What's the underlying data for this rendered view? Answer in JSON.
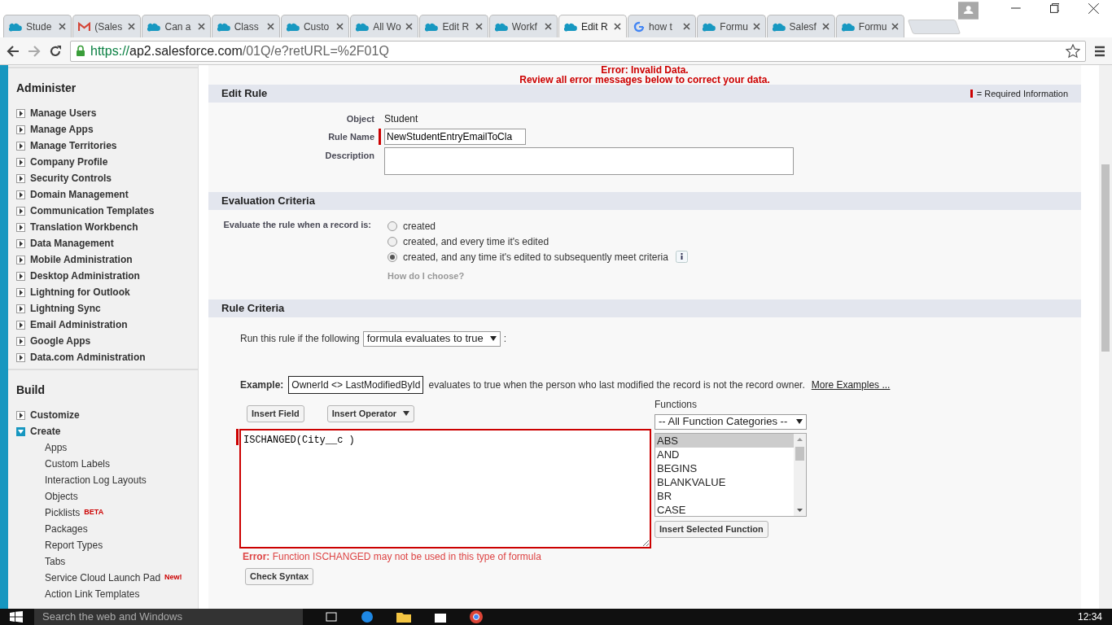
{
  "browser": {
    "tabs": [
      {
        "label": "Stude",
        "kind": "cloud",
        "selected": false
      },
      {
        "label": "(Sales",
        "kind": "mail",
        "selected": false
      },
      {
        "label": "Can a",
        "kind": "cloud",
        "selected": false
      },
      {
        "label": "Class",
        "kind": "cloud",
        "selected": false
      },
      {
        "label": "Custo",
        "kind": "cloud",
        "selected": false
      },
      {
        "label": "All Wo",
        "kind": "cloud",
        "selected": false
      },
      {
        "label": "Edit R",
        "kind": "cloud",
        "selected": false
      },
      {
        "label": "Workf",
        "kind": "cloud",
        "selected": false
      },
      {
        "label": "Edit R",
        "kind": "cloud",
        "selected": true
      },
      {
        "label": "how t",
        "kind": "google",
        "selected": false
      },
      {
        "label": "Formu",
        "kind": "cloud",
        "selected": false
      },
      {
        "label": "Salesf",
        "kind": "cloud",
        "selected": false
      },
      {
        "label": "Formu",
        "kind": "cloud",
        "selected": false
      }
    ],
    "url": {
      "scheme": "https://",
      "host": "ap2.salesforce.com",
      "path": "/01Q/e?retURL=%2F01Q"
    }
  },
  "sidebar": {
    "sections": [
      {
        "title": "Administer",
        "items": [
          {
            "label": "Manage Users",
            "expanded": false
          },
          {
            "label": "Manage Apps",
            "expanded": false
          },
          {
            "label": "Manage Territories",
            "expanded": false
          },
          {
            "label": "Company Profile",
            "expanded": false
          },
          {
            "label": "Security Controls",
            "expanded": false
          },
          {
            "label": "Domain Management",
            "expanded": false
          },
          {
            "label": "Communication Templates",
            "expanded": false
          },
          {
            "label": "Translation Workbench",
            "expanded": false
          },
          {
            "label": "Data Management",
            "expanded": false
          },
          {
            "label": "Mobile Administration",
            "expanded": false
          },
          {
            "label": "Desktop Administration",
            "expanded": false
          },
          {
            "label": "Lightning for Outlook",
            "expanded": false
          },
          {
            "label": "Lightning Sync",
            "expanded": false
          },
          {
            "label": "Email Administration",
            "expanded": false
          },
          {
            "label": "Google Apps",
            "expanded": false
          },
          {
            "label": "Data.com Administration",
            "expanded": false
          }
        ]
      },
      {
        "title": "Build",
        "items": [
          {
            "label": "Customize",
            "expanded": false
          },
          {
            "label": "Create",
            "expanded": true,
            "children": [
              {
                "label": "Apps"
              },
              {
                "label": "Custom Labels"
              },
              {
                "label": "Interaction Log Layouts"
              },
              {
                "label": "Objects"
              },
              {
                "label": "Picklists",
                "badge": "BETA"
              },
              {
                "label": "Packages"
              },
              {
                "label": "Report Types"
              },
              {
                "label": "Tabs"
              },
              {
                "label": "Service Cloud Launch Pad",
                "badge": "New!"
              },
              {
                "label": "Action Link Templates"
              }
            ]
          }
        ]
      }
    ]
  },
  "page": {
    "errors": [
      "Error: Invalid Data.",
      "Review all error messages below to correct your data."
    ],
    "edit_rule": {
      "title": "Edit Rule",
      "required_legend": "= Required Information",
      "fields": [
        {
          "label": "Object",
          "kind": "text",
          "value": "Student",
          "required": false
        },
        {
          "label": "Rule Name",
          "kind": "input",
          "value": "NewStudentEntryEmailToCla",
          "required": true
        },
        {
          "label": "Description",
          "kind": "textarea",
          "required": false
        }
      ]
    },
    "evaluation": {
      "title": "Evaluation Criteria",
      "label": "Evaluate the rule when a record is:",
      "options": [
        {
          "label": "created",
          "selected": false,
          "info": false
        },
        {
          "label": "created, and every time it's edited",
          "selected": false,
          "info": false
        },
        {
          "label": "created, and any time it's edited to subsequently meet criteria",
          "selected": true,
          "info": true
        }
      ],
      "help_link": "How do I choose?"
    },
    "rule_criteria": {
      "title": "Rule Criteria",
      "run_label": "Run this rule if the following",
      "criteria_select": "formula evaluates to true",
      "suffix": ":",
      "example": {
        "label": "Example:",
        "code": "OwnerId <> LastModifiedById",
        "text": "evaluates to true when the person who last modified the record is not the record owner.",
        "link": "More Examples ..."
      },
      "buttons": [
        {
          "label": "Insert Field",
          "kind": "plain"
        },
        {
          "label": "Insert Operator",
          "kind": "dropdown"
        }
      ],
      "formula": "ISCHANGED(City__c )",
      "error": "**Error:** Function ISCHANGED may not be used in this type of formula",
      "check_button": "Check Syntax",
      "functions": {
        "label": "Functions",
        "category": "-- All Function Categories --",
        "items": [
          {
            "label": "ABS",
            "selected": true
          },
          {
            "label": "AND",
            "selected": false
          },
          {
            "label": "BEGINS",
            "selected": false
          },
          {
            "label": "BLANKVALUE",
            "selected": false
          },
          {
            "label": "BR",
            "selected": false
          },
          {
            "label": "CASE",
            "selected": false
          }
        ],
        "insert_button": "Insert Selected Function"
      }
    }
  },
  "taskbar": {
    "search_placeholder": "Search the web and Windows",
    "time": "12:34"
  }
}
